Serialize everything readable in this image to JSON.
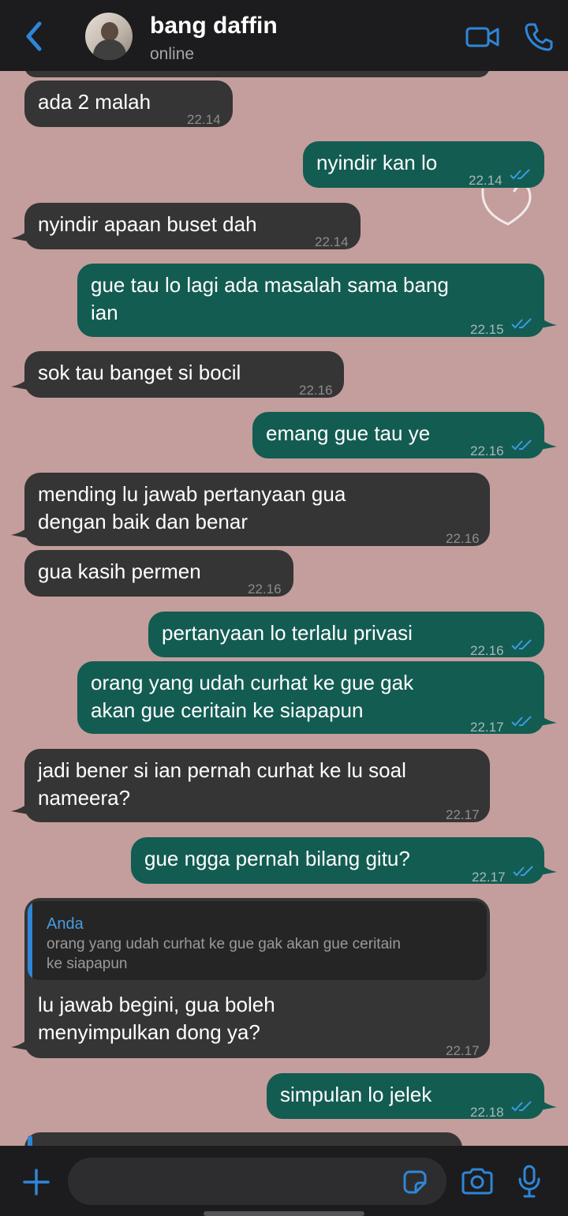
{
  "header": {
    "contact_name": "bang daffin",
    "status": "online",
    "icons": [
      "back-chevron-icon",
      "video-call-icon",
      "phone-call-icon"
    ]
  },
  "messages": [
    {
      "dir": "in",
      "text": "ada 2 malah",
      "time": "22.14"
    },
    {
      "dir": "out",
      "text": "nyindir kan lo",
      "time": "22.14",
      "read": true
    },
    {
      "dir": "in",
      "text": "nyindir apaan buset dah",
      "time": "22.14"
    },
    {
      "dir": "out",
      "text": "gue tau lo lagi ada masalah sama bang ian",
      "time": "22.15",
      "read": true
    },
    {
      "dir": "in",
      "text": "sok tau banget si bocil",
      "time": "22.16"
    },
    {
      "dir": "out",
      "text": "emang gue tau ye",
      "time": "22.16",
      "read": true
    },
    {
      "dir": "in",
      "text": "mending lu jawab pertanyaan gua dengan baik dan benar",
      "time": "22.16"
    },
    {
      "dir": "in",
      "text": "gua kasih permen",
      "time": "22.16"
    },
    {
      "dir": "out",
      "text": "pertanyaan lo terlalu privasi",
      "time": "22.16",
      "read": true
    },
    {
      "dir": "out",
      "text": "orang yang udah curhat ke gue gak akan gue ceritain ke siapapun",
      "time": "22.17",
      "read": true
    },
    {
      "dir": "in",
      "text": "jadi bener si ian pernah curhat ke lu soal nameera?",
      "time": "22.17"
    },
    {
      "dir": "out",
      "text": "gue ngga pernah bilang gitu?",
      "time": "22.17",
      "read": true
    },
    {
      "dir": "in",
      "text": "lu jawab begini, gua boleh menyimpulkan dong ya?",
      "time": "22.17",
      "quote": {
        "author": "Anda",
        "text": "orang yang udah curhat ke gue gak akan gue ceritain ke siapapun"
      }
    },
    {
      "dir": "out",
      "text": "simpulan lo jelek",
      "time": "22.18",
      "read": true
    }
  ],
  "lines": {
    "m3": [
      "gue tau lo lagi ada masalah sama bang",
      "ian"
    ],
    "m6": [
      "mending lu jawab pertanyaan gua",
      "dengan baik dan benar"
    ],
    "m9": [
      "orang yang udah curhat ke gue gak",
      "akan gue ceritain ke siapapun"
    ],
    "m10": [
      "jadi bener si ian pernah curhat ke lu soal",
      "nameera?"
    ],
    "m12": [
      "lu jawab begini, gua boleh",
      "menyimpulkan dong ya?"
    ],
    "q12": [
      "orang yang udah curhat ke gue gak akan gue ceritain",
      "ke siapapun"
    ]
  },
  "footer": {
    "icons": [
      "plus-icon",
      "sticker-icon",
      "camera-icon",
      "microphone-icon"
    ]
  },
  "colors": {
    "wallpaper": "#c49e9c",
    "incoming_bubble": "#353535",
    "outgoing_bubble": "#135c52",
    "accent": "#2f86d7"
  }
}
